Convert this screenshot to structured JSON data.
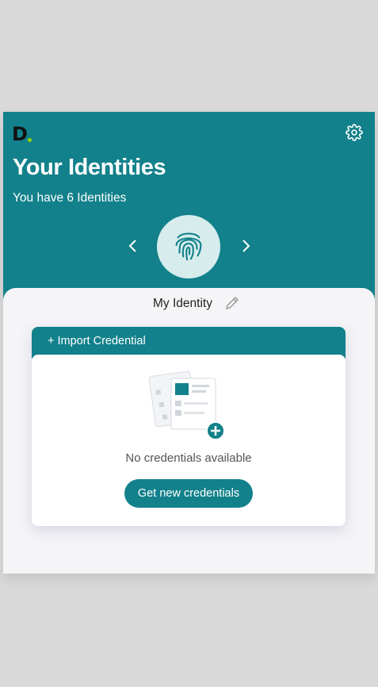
{
  "header": {
    "logo_text": "D",
    "title": "Your Identities",
    "subtitle": "You have 6 Identities",
    "colors": {
      "primary": "#12818b",
      "logo_dot": "#8fd400"
    }
  },
  "icons": {
    "settings": "gear-icon",
    "prev": "chevron-left-icon",
    "next": "chevron-right-icon",
    "identity": "fingerprint-icon",
    "edit": "pencil-icon",
    "empty": "credentials-illustration"
  },
  "identity": {
    "name": "My Identity"
  },
  "credentials": {
    "import_label": "+ Import Credential",
    "empty_text": "No credentials available",
    "get_button_label": "Get new credentials"
  }
}
